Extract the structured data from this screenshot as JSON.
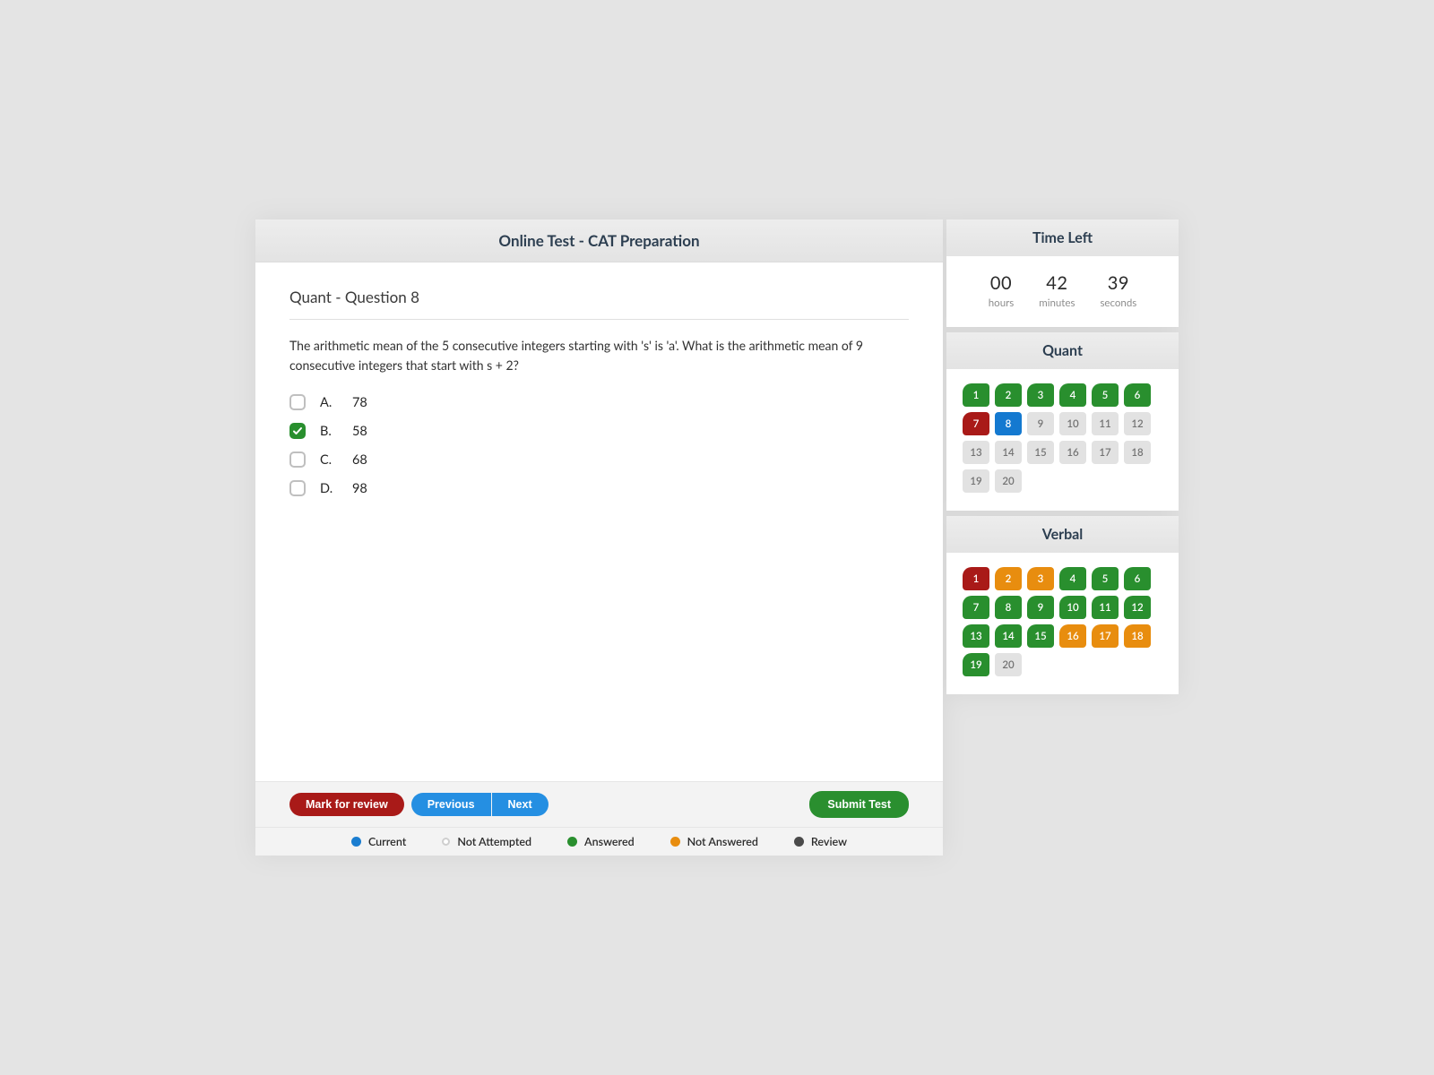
{
  "header": {
    "title": "Online Test - CAT Preparation"
  },
  "question": {
    "heading": "Quant - Question 8",
    "prompt": "The arithmetic mean of the 5 consecutive integers starting with 's' is 'a'. What is the arithmetic mean of 9 consecutive integers that start with s + 2?",
    "options": [
      {
        "letter": "A.",
        "text": "78",
        "selected": false
      },
      {
        "letter": "B.",
        "text": "58",
        "selected": true
      },
      {
        "letter": "C.",
        "text": "68",
        "selected": false
      },
      {
        "letter": "D.",
        "text": "98",
        "selected": false
      }
    ]
  },
  "buttons": {
    "mark": "Mark for review",
    "prev": "Previous",
    "next": "Next",
    "submit": "Submit Test"
  },
  "legend": {
    "current": "Current",
    "notattempted": "Not Attempted",
    "answered": "Answered",
    "notanswered": "Not Answered",
    "review": "Review"
  },
  "timer": {
    "title": "Time Left",
    "hours": {
      "value": "00",
      "label": "hours"
    },
    "minutes": {
      "value": "42",
      "label": "minutes"
    },
    "seconds": {
      "value": "39",
      "label": "seconds"
    }
  },
  "sections": [
    {
      "title": "Quant",
      "questions": [
        {
          "n": "1",
          "state": "answered"
        },
        {
          "n": "2",
          "state": "answered"
        },
        {
          "n": "3",
          "state": "answered"
        },
        {
          "n": "4",
          "state": "answered"
        },
        {
          "n": "5",
          "state": "answered"
        },
        {
          "n": "6",
          "state": "answered"
        },
        {
          "n": "7",
          "state": "review"
        },
        {
          "n": "8",
          "state": "current"
        },
        {
          "n": "9",
          "state": "notattempted"
        },
        {
          "n": "10",
          "state": "notattempted"
        },
        {
          "n": "11",
          "state": "notattempted"
        },
        {
          "n": "12",
          "state": "notattempted"
        },
        {
          "n": "13",
          "state": "notattempted"
        },
        {
          "n": "14",
          "state": "notattempted"
        },
        {
          "n": "15",
          "state": "notattempted"
        },
        {
          "n": "16",
          "state": "notattempted"
        },
        {
          "n": "17",
          "state": "notattempted"
        },
        {
          "n": "18",
          "state": "notattempted"
        },
        {
          "n": "19",
          "state": "notattempted"
        },
        {
          "n": "20",
          "state": "notattempted"
        }
      ]
    },
    {
      "title": "Verbal",
      "questions": [
        {
          "n": "1",
          "state": "review"
        },
        {
          "n": "2",
          "state": "notanswered"
        },
        {
          "n": "3",
          "state": "notanswered"
        },
        {
          "n": "4",
          "state": "answered"
        },
        {
          "n": "5",
          "state": "answered"
        },
        {
          "n": "6",
          "state": "answered"
        },
        {
          "n": "7",
          "state": "answered"
        },
        {
          "n": "8",
          "state": "answered"
        },
        {
          "n": "9",
          "state": "answered"
        },
        {
          "n": "10",
          "state": "answered"
        },
        {
          "n": "11",
          "state": "answered"
        },
        {
          "n": "12",
          "state": "answered"
        },
        {
          "n": "13",
          "state": "answered"
        },
        {
          "n": "14",
          "state": "answered"
        },
        {
          "n": "15",
          "state": "answered"
        },
        {
          "n": "16",
          "state": "notanswered"
        },
        {
          "n": "17",
          "state": "notanswered"
        },
        {
          "n": "18",
          "state": "notanswered"
        },
        {
          "n": "19",
          "state": "answered"
        },
        {
          "n": "20",
          "state": "notattempted"
        }
      ]
    }
  ]
}
